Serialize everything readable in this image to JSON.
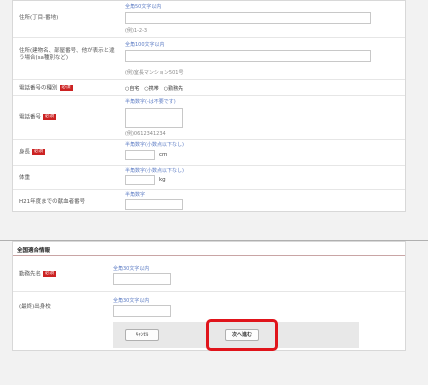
{
  "form": {
    "rows": [
      {
        "label": "住所(丁目-番地)",
        "hint": "全角50文字以内",
        "example": "(例)1-2-3"
      },
      {
        "label": "住所(建物名、部屋番号、他が表示と違う場合(sa種別など)",
        "hint": "全角100文字以内",
        "example": "(例)室長マンション501号"
      },
      {
        "label": "電話番号の種別",
        "required": "必須",
        "options": "○自宅　○携帯　○勤務先"
      },
      {
        "label": "電話番号",
        "required": "必須",
        "hint": "半角数字(-は不要です)",
        "example": "(例)0612341234"
      },
      {
        "label": "身長",
        "required": "必須",
        "hint": "半角数字(小数点以下なし)",
        "unit": "cm"
      },
      {
        "label": "体重",
        "hint": "半角数字(小数点以下なし)",
        "unit": "kg"
      },
      {
        "label": "H21年度までの献血者番号",
        "hint": "半角数字"
      }
    ]
  },
  "section2": {
    "title": "全国適合情報",
    "rows": [
      {
        "label": "勤務先名",
        "required": "必須",
        "hint": "全角30文字以内"
      },
      {
        "label": "(最終)出身校",
        "hint": "全角30文字以内"
      }
    ]
  },
  "buttons": {
    "cancel": "ｷｬﾝｾﾙ",
    "next": "次へ進む"
  }
}
